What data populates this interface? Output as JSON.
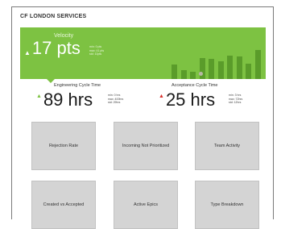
{
  "header": {
    "title": "CF LONDON SERVICES"
  },
  "velocity": {
    "label": "Velocity",
    "value": "17 pts",
    "trend_arrow": "▲",
    "stats": [
      "min: 0 pts",
      "max: 41 pts",
      "std: 10pts"
    ],
    "bar_levels": [
      0.38,
      0.22,
      0.18,
      0.55,
      0.52,
      0.46,
      0.6,
      0.58,
      0.4,
      0.74
    ],
    "colors": {
      "panel": "#7dc242",
      "bars": "#5a9c2a"
    }
  },
  "engineering": {
    "label": "Engineering Cycle Time",
    "value": "89 hrs",
    "trend_arrow": "▲",
    "trend_color": "#7dc242",
    "stats": [
      "min: 0 hrs",
      "max: 400hrs",
      "std: 29hrs"
    ]
  },
  "acceptance": {
    "label": "Acceptance Cycle Time",
    "value": "25 hrs",
    "trend_arrow": "▲",
    "trend_color": "#d9302c",
    "stats": [
      "min: 3 hrs",
      "max: 72hrs",
      "std: 12hrs"
    ]
  },
  "tiles": [
    {
      "label": "Rejection Rate"
    },
    {
      "label": "Incoming Not Prioritized"
    },
    {
      "label": "Team Activity"
    },
    {
      "label": "Created vs Accepted"
    },
    {
      "label": "Active Epics"
    },
    {
      "label": "Type Breakdown"
    }
  ]
}
